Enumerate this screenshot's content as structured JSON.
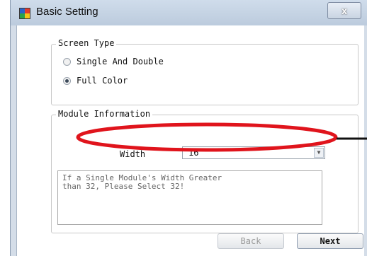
{
  "window": {
    "title": "Basic Setting",
    "close_label": "x"
  },
  "screen_type": {
    "legend": "Screen Type",
    "options": [
      {
        "label": "Single And Double",
        "selected": false
      },
      {
        "label": "Full Color",
        "selected": true
      }
    ]
  },
  "module_info": {
    "legend": "Module Information",
    "width_label": "Width",
    "width_value": "16",
    "note": "If a Single Module's Width Greater\nthan 32, Please Select 32!"
  },
  "buttons": {
    "back": "Back",
    "next": "Next"
  },
  "annotation": {
    "ellipse_color": "#e0141c",
    "line_color": "#111111"
  }
}
